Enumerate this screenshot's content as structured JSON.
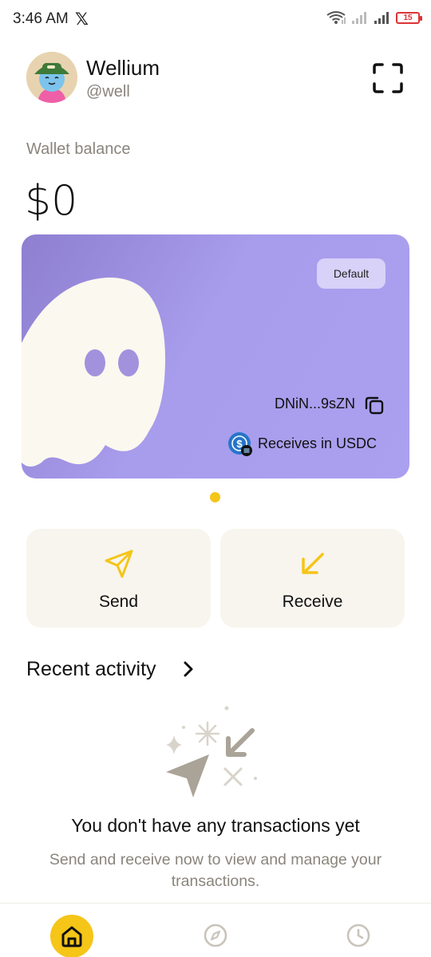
{
  "status_bar": {
    "time": "3:46 AM",
    "app_icon": "x-logo-icon",
    "battery": "15"
  },
  "profile": {
    "name": "Wellium",
    "handle": "@well"
  },
  "wallet": {
    "balance_label": "Wallet balance",
    "balance": "$0"
  },
  "card": {
    "badge": "Default",
    "address": "DNiN...9sZN",
    "receives_label": "Receives in USDC",
    "color": "#a89cec"
  },
  "actions": {
    "send_label": "Send",
    "receive_label": "Receive",
    "accent": "#f5c518"
  },
  "activity": {
    "title": "Recent activity",
    "empty_title": "You don't have any transactions yet",
    "empty_subtitle": "Send and receive now to view and manage your transactions."
  },
  "nav": {
    "items": [
      "home-icon",
      "compass-icon",
      "history-icon"
    ],
    "active": "home-icon"
  }
}
